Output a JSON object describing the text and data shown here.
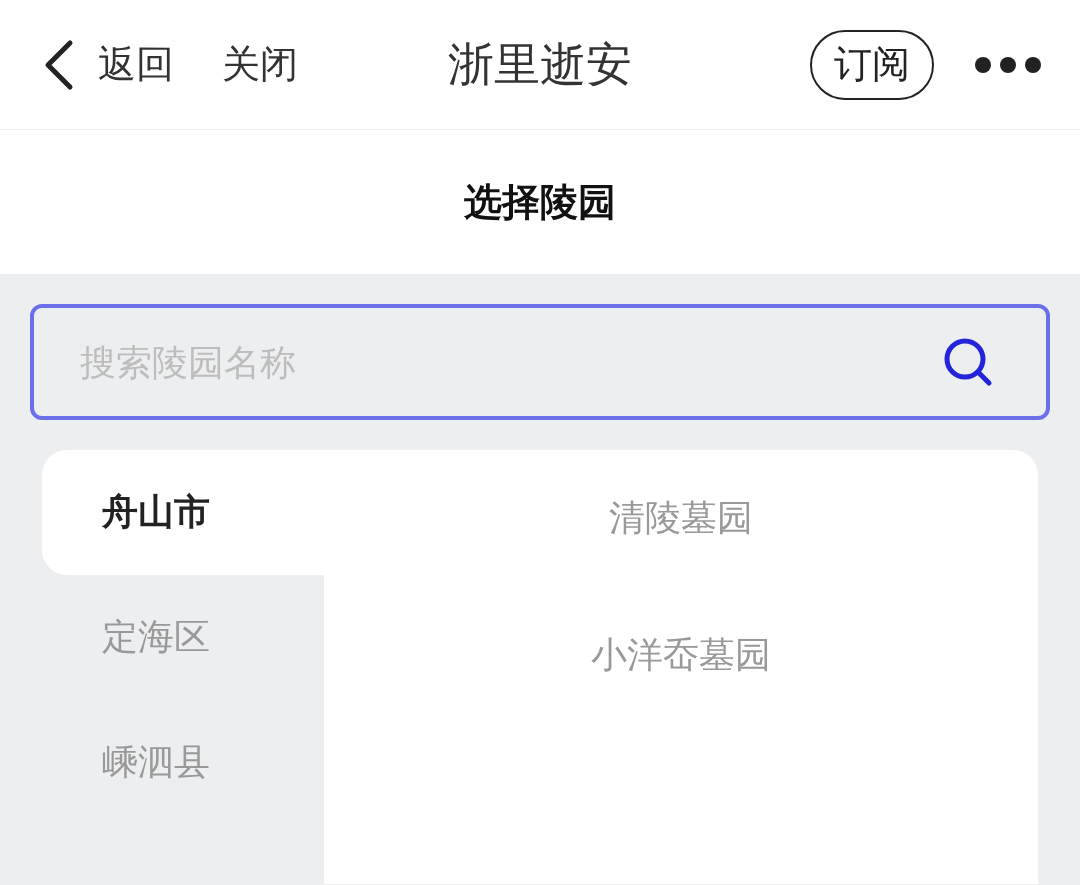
{
  "nav": {
    "back": "返回",
    "close": "关闭",
    "title": "浙里逝安",
    "subscribe": "订阅"
  },
  "header": {
    "title": "选择陵园"
  },
  "search": {
    "placeholder": "搜索陵园名称"
  },
  "regions": [
    {
      "label": "舟山市",
      "selected": true
    },
    {
      "label": "定海区",
      "selected": false
    },
    {
      "label": "嵊泗县",
      "selected": false
    }
  ],
  "cemeteries": [
    {
      "label": "清陵墓园"
    },
    {
      "label": "小洋岙墓园"
    }
  ]
}
